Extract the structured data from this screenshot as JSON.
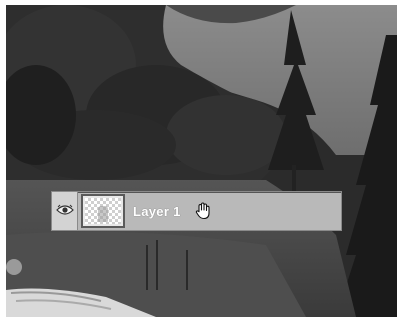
{
  "layers_panel": {
    "layer": {
      "name": "Layer 1",
      "visibility_icon": "eye-icon",
      "thumbnail": "transparent-layer-thumbnail"
    },
    "cursor_icon": "hand-grab-icon"
  },
  "canvas": {
    "background_icon": "landscape-photo-grayscale"
  },
  "colors": {
    "row_background": "#b9b9b9",
    "layer_name_text": "#ffffff"
  }
}
